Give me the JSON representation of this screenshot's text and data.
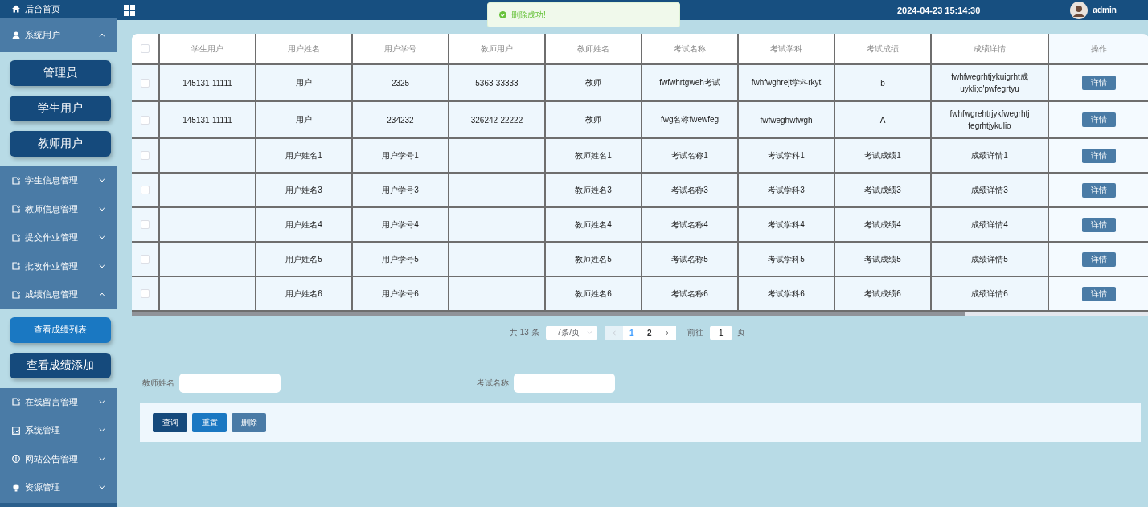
{
  "sidebar": {
    "items": [
      {
        "kind": "home",
        "label": "后台首页"
      },
      {
        "kind": "menu",
        "label": "系统用户",
        "expanded": true,
        "children": [
          {
            "label": "管理员",
            "selected": false
          },
          {
            "label": "学生用户",
            "selected": false
          },
          {
            "label": "教师用户",
            "selected": false
          }
        ]
      },
      {
        "kind": "menu",
        "label": "学生信息管理",
        "expanded": false
      },
      {
        "kind": "menu",
        "label": "教师信息管理",
        "expanded": false
      },
      {
        "kind": "menu",
        "label": "提交作业管理",
        "expanded": false
      },
      {
        "kind": "menu",
        "label": "批改作业管理",
        "expanded": false
      },
      {
        "kind": "menu",
        "label": "成绩信息管理",
        "expanded": true,
        "children": [
          {
            "label": "查看成绩列表",
            "selected": true
          },
          {
            "label": "查看成绩添加",
            "selected": false
          }
        ]
      },
      {
        "kind": "menu",
        "label": "在线留言管理",
        "expanded": false
      },
      {
        "kind": "menu",
        "label": "系统管理",
        "expanded": false
      },
      {
        "kind": "menu",
        "label": "网站公告管理",
        "expanded": false
      },
      {
        "kind": "menu",
        "label": "资源管理",
        "expanded": false
      }
    ]
  },
  "header": {
    "datetime": "2024-04-23 15:14:30",
    "user": "admin"
  },
  "toast": {
    "message": "删除成功!"
  },
  "table": {
    "header_checked": false,
    "columns": [
      "学生用户",
      "用户姓名",
      "用户学号",
      "教师用户",
      "教师姓名",
      "考试名称",
      "考试学科",
      "考试成绩",
      "成绩详情",
      "操作"
    ],
    "rows": [
      {
        "checked": false,
        "cells": [
          "145131-11111",
          "用户",
          "2325",
          "5363-33333",
          "教师",
          "fwfwhrtgweh考试",
          "fwhfwghrejt学科rkyt",
          "b",
          "fwhfwegrhtjykuigrht成\nuykli;o'pwfegrtyu"
        ],
        "action": "详情"
      },
      {
        "checked": false,
        "cells": [
          "145131-11111",
          "用户",
          "234232",
          "326242-22222",
          "教师",
          "fwg名称fwewfeg",
          "fwfweghwfwgh",
          "A",
          "fwhfwgrehtrjykfwegrhtj\nfegrhtjykulio"
        ],
        "action": "详情"
      },
      {
        "checked": false,
        "cells": [
          null,
          "用户姓名1",
          "用户学号1",
          null,
          "教师姓名1",
          "考试名称1",
          "考试学科1",
          "考试成绩1",
          "成绩详情1"
        ],
        "action": "详情"
      },
      {
        "checked": false,
        "cells": [
          null,
          "用户姓名3",
          "用户学号3",
          null,
          "教师姓名3",
          "考试名称3",
          "考试学科3",
          "考试成绩3",
          "成绩详情3"
        ],
        "action": "详情"
      },
      {
        "checked": false,
        "cells": [
          null,
          "用户姓名4",
          "用户学号4",
          null,
          "教师姓名4",
          "考试名称4",
          "考试学科4",
          "考试成绩4",
          "成绩详情4"
        ],
        "action": "详情"
      },
      {
        "checked": false,
        "cells": [
          null,
          "用户姓名5",
          "用户学号5",
          null,
          "教师姓名5",
          "考试名称5",
          "考试学科5",
          "考试成绩5",
          "成绩详情5"
        ],
        "action": "详情"
      },
      {
        "checked": false,
        "cells": [
          null,
          "用户姓名6",
          "用户学号6",
          null,
          "教师姓名6",
          "考试名称6",
          "考试学科6",
          "考试成绩6",
          "成绩详情6"
        ],
        "action": "详情"
      }
    ]
  },
  "pagination": {
    "total": "共 13 条",
    "page_size": "7条/页",
    "prev_disabled": true,
    "next_disabled": false,
    "pages": [
      {
        "label": "1",
        "selected": true
      },
      {
        "label": "2",
        "selected": false
      }
    ],
    "goto_label": "前往",
    "goto_value": "1",
    "goto_suffix": "页"
  },
  "search": {
    "fields": [
      {
        "label": "教师姓名"
      },
      {
        "label": "考试名称"
      }
    ],
    "buttons": [
      {
        "label": "查询",
        "kind": "primary"
      },
      {
        "label": "重置",
        "kind": "info"
      },
      {
        "label": "删除",
        "kind": "danger"
      }
    ]
  }
}
